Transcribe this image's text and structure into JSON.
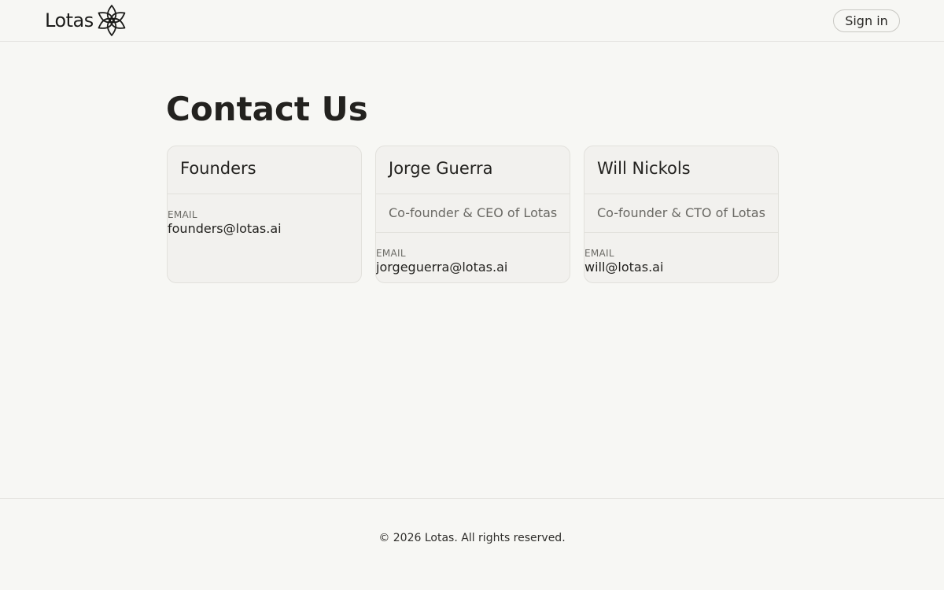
{
  "header": {
    "logo_text": "Lotas",
    "signin_label": "Sign in"
  },
  "main": {
    "title": "Contact Us",
    "cards": [
      {
        "name": "Founders",
        "role": "",
        "email_label": "EMAIL",
        "email": "founders@lotas.ai",
        "icon": "arrow-up-right-icon"
      },
      {
        "name": "Jorge Guerra",
        "role": "Co-founder & CEO of Lotas",
        "email_label": "EMAIL",
        "email": "jorgeguerra@lotas.ai",
        "icon": "arrow-up-right-icon"
      },
      {
        "name": "Will Nickols",
        "role": "Co-founder & CTO of Lotas",
        "email_label": "EMAIL",
        "email": "will@lotas.ai",
        "icon": "arrow-up-right-icon"
      }
    ]
  },
  "footer": {
    "copyright": "© 2026 Lotas. All rights reserved."
  },
  "colors": {
    "background": "#f7f7f4",
    "card_background": "#f2f1ee",
    "text": "#23221f",
    "muted_text": "#6a6964",
    "border": "#e2e1dc"
  }
}
